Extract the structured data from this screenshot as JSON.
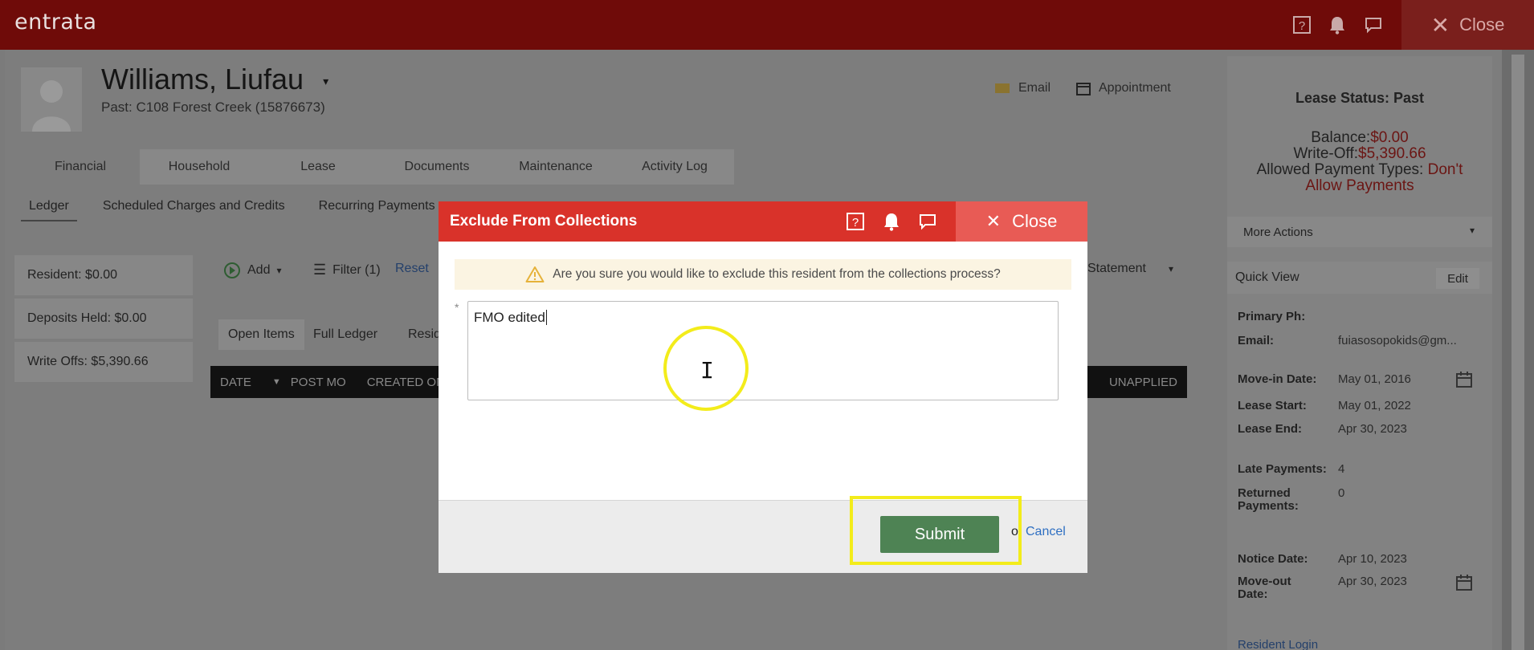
{
  "topbar": {
    "logo": "entrata",
    "close_label": "Close",
    "icons": [
      "help-icon",
      "bell-icon",
      "chat-icon"
    ]
  },
  "resident": {
    "name": "Williams, Liufau",
    "subtitle": "Past: C108 Forest Creek (15876673)"
  },
  "header_links": {
    "email": "Email",
    "appointment": "Appointment"
  },
  "tabs": [
    "Financial",
    "Household",
    "Lease",
    "Documents",
    "Maintenance",
    "Activity Log"
  ],
  "subtabs": [
    "Ledger",
    "Scheduled Charges and Credits",
    "Recurring Payments"
  ],
  "left_summary": [
    "Resident: $0.00",
    "Deposits Held: $0.00",
    "Write Offs: $5,390.66"
  ],
  "toolbar": {
    "add": "Add",
    "filter": "Filter (1)",
    "reset": "Reset",
    "statement": "Statement"
  },
  "ledger_views": [
    "Open Items",
    "Full Ledger",
    "Resid"
  ],
  "grid_columns": [
    "DATE",
    "POST MO",
    "CREATED ON",
    "UNAPPLIED"
  ],
  "right_panel": {
    "lease_status": "Lease Status: Past",
    "balance_label": "Balance:",
    "balance_value": "$0.00",
    "writeoff_label": "Write-Off:",
    "writeoff_value": "$5,390.66",
    "payment_types_label": "Allowed Payment Types:",
    "payment_types_value_1": "Don't",
    "payment_types_value_2": "Allow Payments",
    "more_actions": "More Actions",
    "quick_view": "Quick View",
    "edit": "Edit",
    "primary_ph": "Primary Ph:",
    "email_label": "Email:",
    "email_value": "fuiasosopokids@gm...",
    "movein_label": "Move-in Date:",
    "movein_value": "May 01, 2016",
    "lease_start_label": "Lease Start:",
    "lease_start_value": "May 01, 2022",
    "lease_end_label": "Lease End:",
    "lease_end_value": "Apr 30, 2023",
    "late_label": "Late Payments:",
    "late_value": "4",
    "returned_label_1": "Returned",
    "returned_label_2": "Payments:",
    "returned_value": "0",
    "notice_label": "Notice Date:",
    "notice_value": "Apr 10, 2023",
    "moveout_label_1": "Move-out",
    "moveout_label_2": "Date:",
    "moveout_value": "Apr 30, 2023",
    "resident_login": "Resident Login"
  },
  "modal": {
    "title": "Exclude From Collections",
    "close_label": "Close",
    "warning": "Are you sure you would like to exclude this resident from the collections process?",
    "required_mark": "*",
    "note_value": "FMO edited",
    "submit": "Submit",
    "or": "o",
    "cancel": "Cancel"
  },
  "colors": {
    "topbar": "#6f0b09",
    "modal_header": "#d9322a",
    "submit": "#4e8354",
    "highlight": "#f3ec1b"
  }
}
